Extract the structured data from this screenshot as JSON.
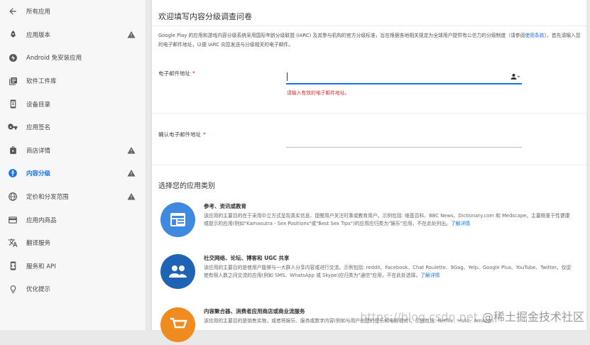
{
  "sidebar": {
    "back_label": "所有应用",
    "items": [
      {
        "label": "应用版本",
        "icon": "rocket-icon",
        "warn": true,
        "active": false
      },
      {
        "label": "Android 免安装应用",
        "icon": "instant-app-icon",
        "warn": false,
        "active": false
      },
      {
        "label": "软件工件库",
        "icon": "library-icon",
        "warn": false,
        "active": false
      },
      {
        "label": "设备目录",
        "icon": "device-catalog-icon",
        "warn": false,
        "active": false
      },
      {
        "label": "应用签名",
        "icon": "key-icon",
        "warn": false,
        "active": false
      },
      {
        "label": "商店详情",
        "icon": "store-bag-icon",
        "warn": true,
        "active": false
      },
      {
        "label": "内容分级",
        "icon": "content-rating-icon",
        "warn": true,
        "active": true
      },
      {
        "label": "定价和分发范围",
        "icon": "globe-icon",
        "warn": true,
        "active": false
      },
      {
        "label": "应用内商品",
        "icon": "card-icon",
        "warn": false,
        "active": false
      },
      {
        "label": "翻译服务",
        "icon": "translate-icon",
        "warn": false,
        "active": false
      },
      {
        "label": "服务和 API",
        "icon": "api-icon",
        "warn": false,
        "active": false
      },
      {
        "label": "优化提示",
        "icon": "bulb-icon",
        "warn": false,
        "active": false
      }
    ]
  },
  "main": {
    "title": "欢迎填写内容分级调查问卷",
    "intro_text": "Google Play 的应用和游戏内容分级系统采用国际年龄分级联盟 (IARC) 及其参与机构的官方分级标准，旨在根据各地相关规定为全球用户提供有公信力的分级制度（请参阅",
    "intro_link": "使用条款",
    "intro_text2": "）。首先请输入您的电子邮件地址，以便 IARC 向您发送与分级相关的电子邮件。",
    "email_label": "电子邮件地址",
    "email_error": "请输入有效的电子邮件地址。",
    "confirm_label": "确认电子邮件地址",
    "required_mark": "*",
    "category_section_title": "选择您的应用类别",
    "learn_more": "了解详情",
    "categories": [
      {
        "title": "参考、资讯或教育",
        "desc": "该应用的主要目的在于采用中立方式呈现真实信息、提醒用户关注时事或教育用户。示例包括: 维基百科、BBC News、Dictionary.com 和 Medscape。主要侧重于性健康或提示的应用(例如\"Kamasutra - Sex Positions\"或\"Best Sex Tips\")的应用应归类为\"娱乐\"应用，不在此处列出。",
        "icon": "reference-icon",
        "color": "#3f8ae0"
      },
      {
        "title": "社交网络、论坛、博客和 UGC 共享",
        "desc": "该应用的主要目的是使用户能够与一大群人分享内容或进行交流。示例包括: reddit、Facebook、Chat Roulette、9Gag、Yelp、Google Plus、YouTube、Twitter。仅促使有限人数之间交流的应用(例如 SMS、WhatsApp 或 Skype)应归类为\"通信\"应用，不在此处选择。",
        "icon": "people-icon",
        "color": "#1f63b5"
      },
      {
        "title": "内容聚合器、消费者应用商店或商业流服务",
        "desc": "该应用的主要目的是销售实物，或者将娱乐、服务或数字内容(例如与用户创建的音乐和电影相对)。示例包括: Netflix、Hulu、Amazon",
        "icon": "cart-icon",
        "color": "#ef8b1f"
      }
    ]
  },
  "watermark": {
    "url": "https://blog.csdn.net",
    "source": "@稀土掘金技术社区"
  },
  "colors": {
    "accent": "#1a73e8",
    "error": "#d32f2f",
    "warn": "#616161"
  }
}
